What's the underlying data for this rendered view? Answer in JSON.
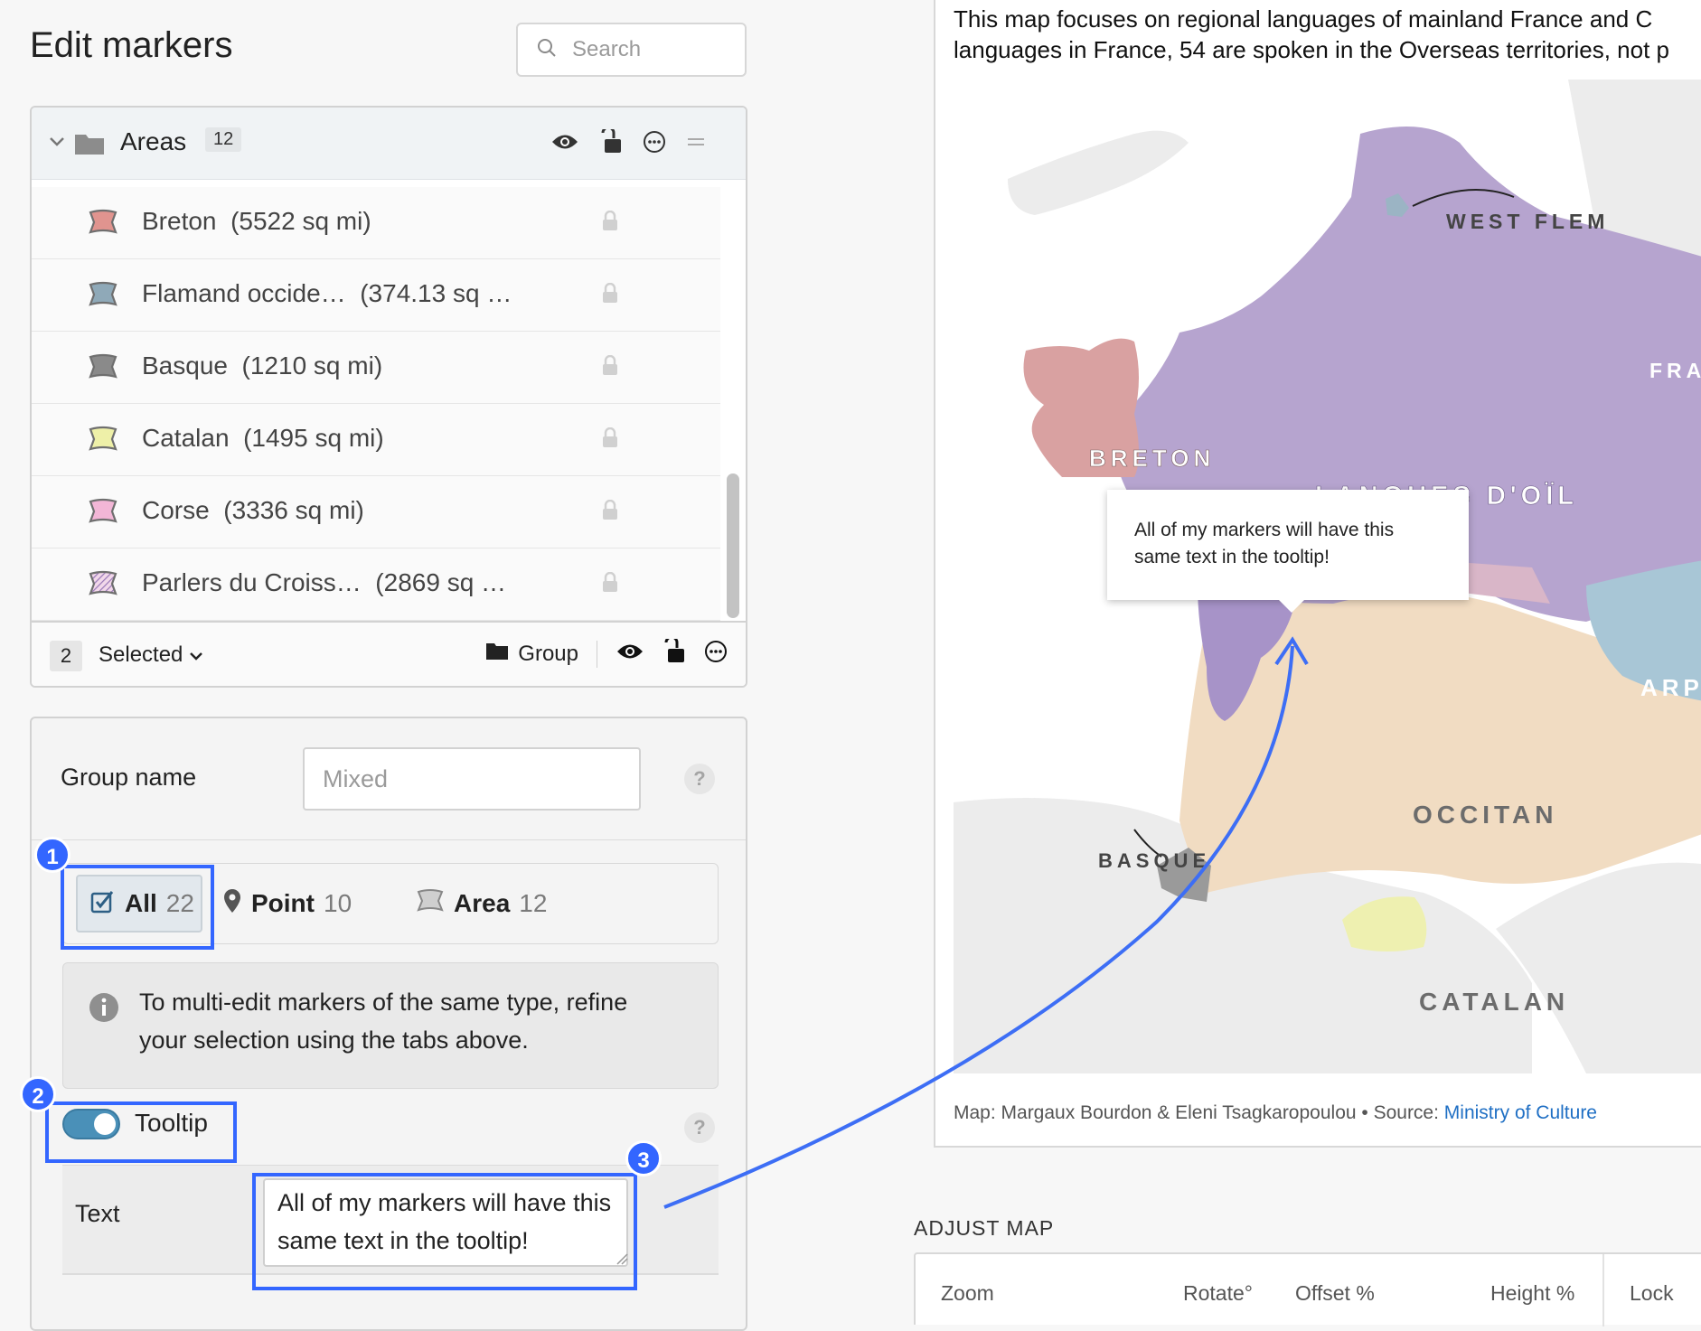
{
  "header": {
    "title": "Edit markers",
    "search_placeholder": "Search"
  },
  "layers": {
    "group_name": "Areas",
    "group_count": "12",
    "items": [
      {
        "name": "Breton",
        "size": "(5522 sq mi)",
        "color": "#e0948f"
      },
      {
        "name": "Flamand occide…",
        "size": "(374.13 sq …",
        "color": "#8fa9b8"
      },
      {
        "name": "Basque",
        "size": "(1210 sq mi)",
        "color": "#8a8a8a"
      },
      {
        "name": "Catalan",
        "size": "(1495 sq mi)",
        "color": "#eef0a8"
      },
      {
        "name": "Corse",
        "size": "(3336 sq mi)",
        "color": "#f2b6d6"
      },
      {
        "name": "Parlers du Croiss…",
        "size": "(2869 sq …",
        "color": "#c99ac2"
      }
    ],
    "footer": {
      "selected_count": "2",
      "selected_label": "Selected",
      "group_label": "Group"
    }
  },
  "settings": {
    "group_name_label": "Group name",
    "group_name_placeholder": "Mixed",
    "help": "?",
    "tabs": [
      {
        "label": "All",
        "count": "22"
      },
      {
        "label": "Point",
        "count": "10"
      },
      {
        "label": "Area",
        "count": "12"
      }
    ],
    "info": "To multi-edit markers of the same type, refine your selection using the tabs above.",
    "tooltip_label": "Tooltip",
    "text_label": "Text",
    "text_value": "All of my markers will have this same text in the tooltip!"
  },
  "annotations": [
    "1",
    "2",
    "3"
  ],
  "map": {
    "description_line1": "This map focuses on regional languages of mainland France and C",
    "description_line2": "languages in France, 54 are spoken in the Overseas territories, not p",
    "labels": {
      "west_flem": "WEST FLEM",
      "fra": "FRA",
      "breton": "BRETON",
      "oil": "LANGUES D'OÏL",
      "arpit": "ARPIT",
      "occitan": "OCCITAN",
      "basque": "BASQUE",
      "catalan": "CATALAN"
    },
    "tooltip_text": "All of my markers will have this same text in the tooltip!",
    "credit_prefix": "Map: Margaux Bourdon & Eleni Tsagkaropoulou • Source: ",
    "credit_link": "Ministry of Culture",
    "colors": {
      "oil": "#b6a4cf",
      "breton": "#d9a1a1",
      "occitan": "#f1dcc2",
      "arpit": "#a8c6d6",
      "basque": "#9a9a9a",
      "catalan": "#eef0b0",
      "land": "#ececec",
      "accent": "#3366ff"
    }
  },
  "adjust": {
    "title": "ADJUST MAP",
    "columns": [
      "Zoom",
      "Rotate°",
      "Offset %",
      "Height %",
      "Lock"
    ]
  }
}
